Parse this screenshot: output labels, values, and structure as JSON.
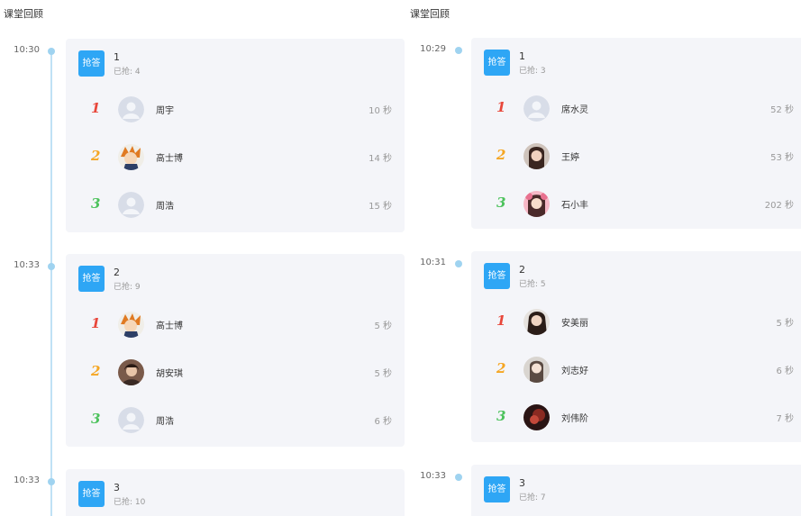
{
  "left_panel": {
    "title": "课堂回顾",
    "sessions": [
      {
        "time": "10:30",
        "badge": "抢答",
        "number": "1",
        "answered": "已抢: 4",
        "rows": [
          {
            "rank": "1",
            "name": "周宇",
            "duration": "10 秒",
            "avatar": "default-avatar"
          },
          {
            "rank": "2",
            "name": "高士博",
            "duration": "14 秒",
            "avatar": "cartoon-avatar"
          },
          {
            "rank": "3",
            "name": "周浩",
            "duration": "15 秒",
            "avatar": "default-avatar"
          }
        ]
      },
      {
        "time": "10:33",
        "badge": "抢答",
        "number": "2",
        "answered": "已抢: 9",
        "rows": [
          {
            "rank": "1",
            "name": "高士博",
            "duration": "5 秒",
            "avatar": "cartoon-avatar"
          },
          {
            "rank": "2",
            "name": "胡安琪",
            "duration": "5 秒",
            "avatar": "photo-avatar"
          },
          {
            "rank": "3",
            "name": "周浩",
            "duration": "6 秒",
            "avatar": "default-avatar"
          }
        ]
      },
      {
        "time": "10:33",
        "badge": "抢答",
        "number": "3",
        "answered": "已抢: 10",
        "rows": []
      }
    ]
  },
  "right_panel": {
    "title": "课堂回顾",
    "sessions": [
      {
        "time": "10:29",
        "badge": "抢答",
        "number": "1",
        "answered": "已抢: 3",
        "rows": [
          {
            "rank": "1",
            "name": "席水灵",
            "duration": "52 秒",
            "avatar": "default-avatar"
          },
          {
            "rank": "2",
            "name": "王婷",
            "duration": "53 秒",
            "avatar": "photo-avatar"
          },
          {
            "rank": "3",
            "name": "石小丰",
            "duration": "202 秒",
            "avatar": "pink-photo-avatar"
          }
        ]
      },
      {
        "time": "10:31",
        "badge": "抢答",
        "number": "2",
        "answered": "已抢: 5",
        "rows": [
          {
            "rank": "1",
            "name": "安美丽",
            "duration": "5 秒",
            "avatar": "photo-avatar"
          },
          {
            "rank": "2",
            "name": "刘志好",
            "duration": "6 秒",
            "avatar": "photo-avatar"
          },
          {
            "rank": "3",
            "name": "刘伟阶",
            "duration": "7 秒",
            "avatar": "dark-photo-avatar"
          }
        ]
      },
      {
        "time": "10:33",
        "badge": "抢答",
        "number": "3",
        "answered": "已抢: 7",
        "rows": []
      }
    ]
  },
  "colors": {
    "accent": "#2ea6f5",
    "card_bg": "#f4f5f9",
    "timeline": "#bfe1f5",
    "rank1": "#e8473b",
    "rank2": "#f5a623",
    "rank3": "#4cc25c"
  }
}
